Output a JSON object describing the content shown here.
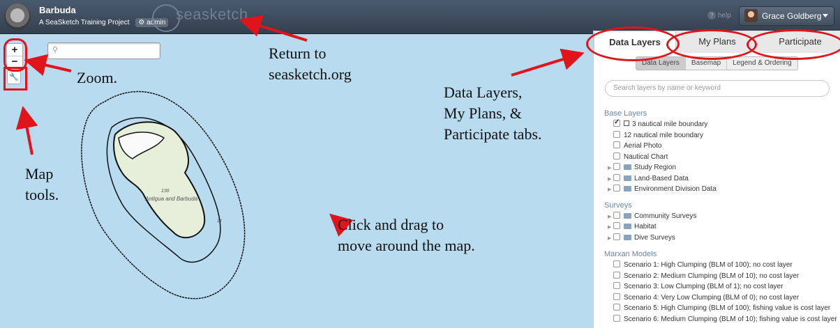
{
  "header": {
    "title": "Barbuda",
    "subtitle": "A SeaSketch Training Project",
    "admin_label": "admin",
    "brand": "seasketch",
    "help_label": "help",
    "user_name": "Grace Goldberg"
  },
  "map": {
    "zoom_in": "+",
    "zoom_out": "−",
    "tool_icon": "wrench-icon",
    "search_placeholder": "",
    "island_label": "Antigua and Barbuda",
    "depth_label": "136",
    "depth_label_2": "14"
  },
  "annotations": {
    "return": "Return to\nseasketch.org",
    "zoom": "Zoom.",
    "tabs": "Data Layers,\nMy Plans, &\nParticipate tabs.",
    "tools": "Map\ntools.",
    "drag": "Click and drag to\nmove around the map.",
    "accent_color": "#e0151b"
  },
  "panel": {
    "tabs": [
      "Data Layers",
      "My Plans",
      "Participate"
    ],
    "subtabs": [
      "Data Layers",
      "Basemap",
      "Legend & Ordering"
    ],
    "search_placeholder": "Search layers by name or keyword",
    "sections": [
      {
        "title": "Base Layers",
        "items": [
          {
            "label": "3 nautical mile boundary",
            "checked": true,
            "type": "layer"
          },
          {
            "label": "12 nautical mile boundary",
            "checked": false,
            "type": "layer"
          },
          {
            "label": "Aerial Photo",
            "checked": false,
            "type": "layer"
          },
          {
            "label": "Nautical Chart",
            "checked": false,
            "type": "layer"
          },
          {
            "label": "Study Region",
            "checked": false,
            "type": "folder"
          },
          {
            "label": "Land-Based Data",
            "checked": false,
            "type": "folder"
          },
          {
            "label": "Environment Division Data",
            "checked": false,
            "type": "folder"
          }
        ]
      },
      {
        "title": "Surveys",
        "items": [
          {
            "label": "Community Surveys",
            "checked": false,
            "type": "folder"
          },
          {
            "label": "Habitat",
            "checked": false,
            "type": "folder"
          },
          {
            "label": "Dive Surveys",
            "checked": false,
            "type": "folder"
          }
        ]
      },
      {
        "title": "Marxan Models",
        "items": [
          {
            "label": "Scenario 1: High Clumping (BLM of 100); no cost layer",
            "checked": false,
            "type": "layer"
          },
          {
            "label": "Scenario 2: Medium Clumping (BLM of 10); no cost layer",
            "checked": false,
            "type": "layer"
          },
          {
            "label": "Scenario 3: Low Clumping (BLM of 1); no cost layer",
            "checked": false,
            "type": "layer"
          },
          {
            "label": "Scenario 4: Very Low Clumping (BLM of 0); no cost layer",
            "checked": false,
            "type": "layer"
          },
          {
            "label": "Scenario 5: High Clumping (BLM of 100); fishing value is cost layer",
            "checked": false,
            "type": "layer"
          },
          {
            "label": "Scenario 6: Medium Clumping (BLM of 10); fishing value is cost layer",
            "checked": false,
            "type": "layer"
          }
        ]
      }
    ]
  }
}
